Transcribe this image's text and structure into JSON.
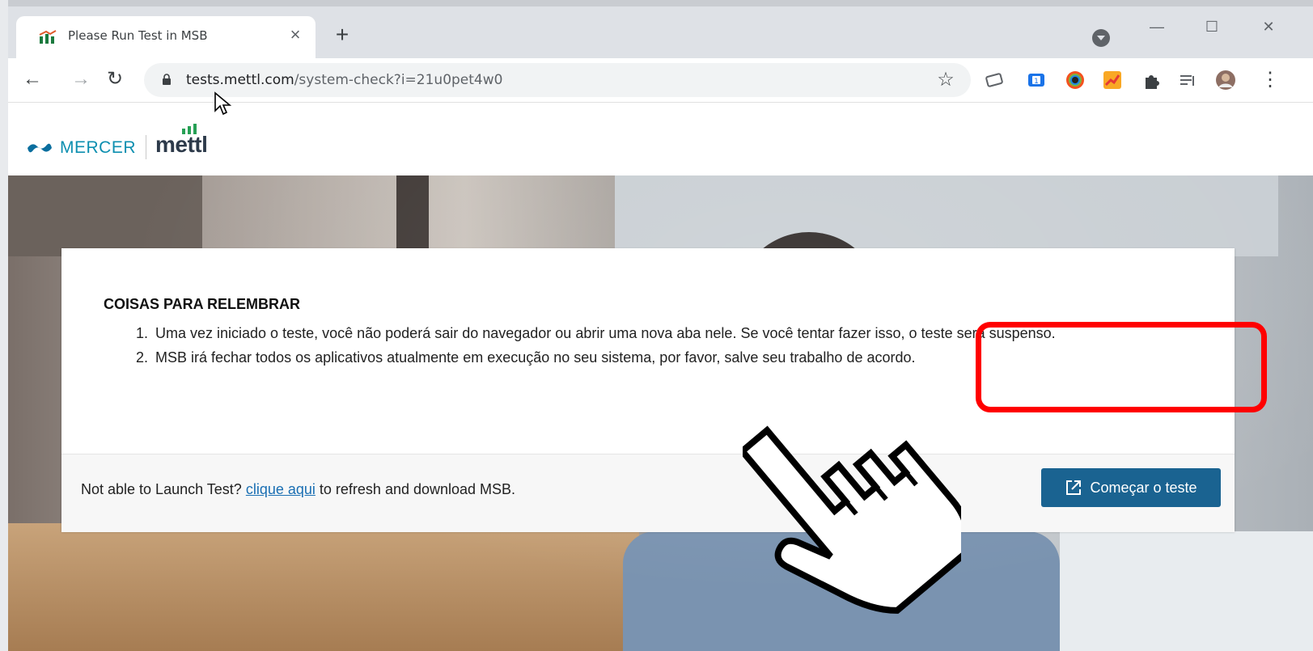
{
  "browser": {
    "tab_title": "Please Run Test in MSB",
    "tab_close": "×",
    "new_tab": "+",
    "url_domain": "tests.mettl.com",
    "url_path": "/system-check?i=21u0pet4w0",
    "window_controls": {
      "minimize": "—",
      "maximize": "☐",
      "close": "✕"
    }
  },
  "site": {
    "brand_mercer": "MERCER",
    "brand_mettl": "mettl"
  },
  "card": {
    "title": "COISAS PARA RELEMBRAR",
    "items": [
      "Uma vez iniciado o teste, você não poderá sair do navegador ou abrir uma nova aba nele. Se você tentar fazer isso, o teste será suspenso.",
      "MSB irá fechar todos os aplicativos atualmente em execução no seu sistema, por favor, salve seu trabalho de acordo."
    ],
    "footer": {
      "prefix": "Not able to Launch Test?",
      "link": "clique aqui",
      "suffix": "to refresh and download MSB."
    },
    "start_button": "Começar o teste"
  },
  "colors": {
    "button": "#1a6391",
    "highlight": "#ff0000",
    "link": "#1a6fb3"
  }
}
